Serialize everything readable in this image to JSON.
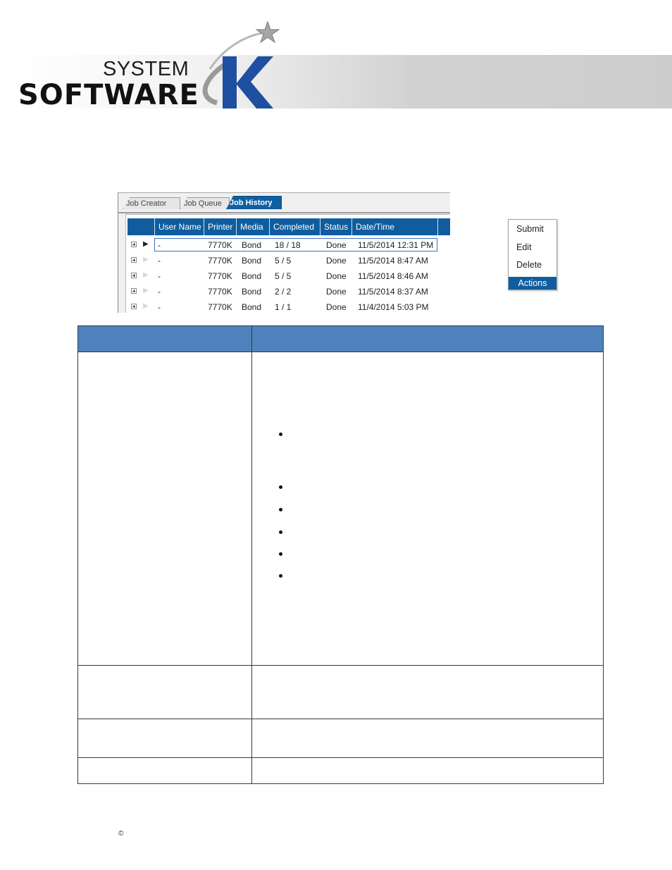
{
  "header": {
    "logo_line1": "SYSTEM",
    "logo_line2": "SOFTWARE",
    "logo_letter": "K",
    "logo_color": "#1e4fa0"
  },
  "job_history_screenshot": {
    "tabs": [
      "Job Creator",
      "Job Queue",
      "Job History"
    ],
    "active_tab": "Job History",
    "columns": [
      "User Name",
      "Printer",
      "Media",
      "Completed",
      "Status",
      "Date/Time"
    ],
    "rows": [
      {
        "user": "-",
        "printer": "7770K",
        "media": "Bond",
        "completed": "18 / 18",
        "status": "Done",
        "datetime": "11/5/2014 12:31 PM",
        "selected": true
      },
      {
        "user": "-",
        "printer": "7770K",
        "media": "Bond",
        "completed": "5 / 5",
        "status": "Done",
        "datetime": "11/5/2014 8:47 AM",
        "selected": false
      },
      {
        "user": "-",
        "printer": "7770K",
        "media": "Bond",
        "completed": "5 / 5",
        "status": "Done",
        "datetime": "11/5/2014 8:46 AM",
        "selected": false
      },
      {
        "user": "-",
        "printer": "7770K",
        "media": "Bond",
        "completed": "2 / 2",
        "status": "Done",
        "datetime": "11/5/2014 8:37 AM",
        "selected": false
      },
      {
        "user": "-",
        "printer": "7770K",
        "media": "Bond",
        "completed": "1 / 1",
        "status": "Done",
        "datetime": "11/4/2014 5:03 PM",
        "selected": false
      }
    ],
    "accent_color": "#0f5d9e"
  },
  "actions_menu": {
    "items": [
      "Submit",
      "Edit",
      "Delete"
    ],
    "title": "Actions"
  },
  "footer": {
    "copyright": "©"
  }
}
